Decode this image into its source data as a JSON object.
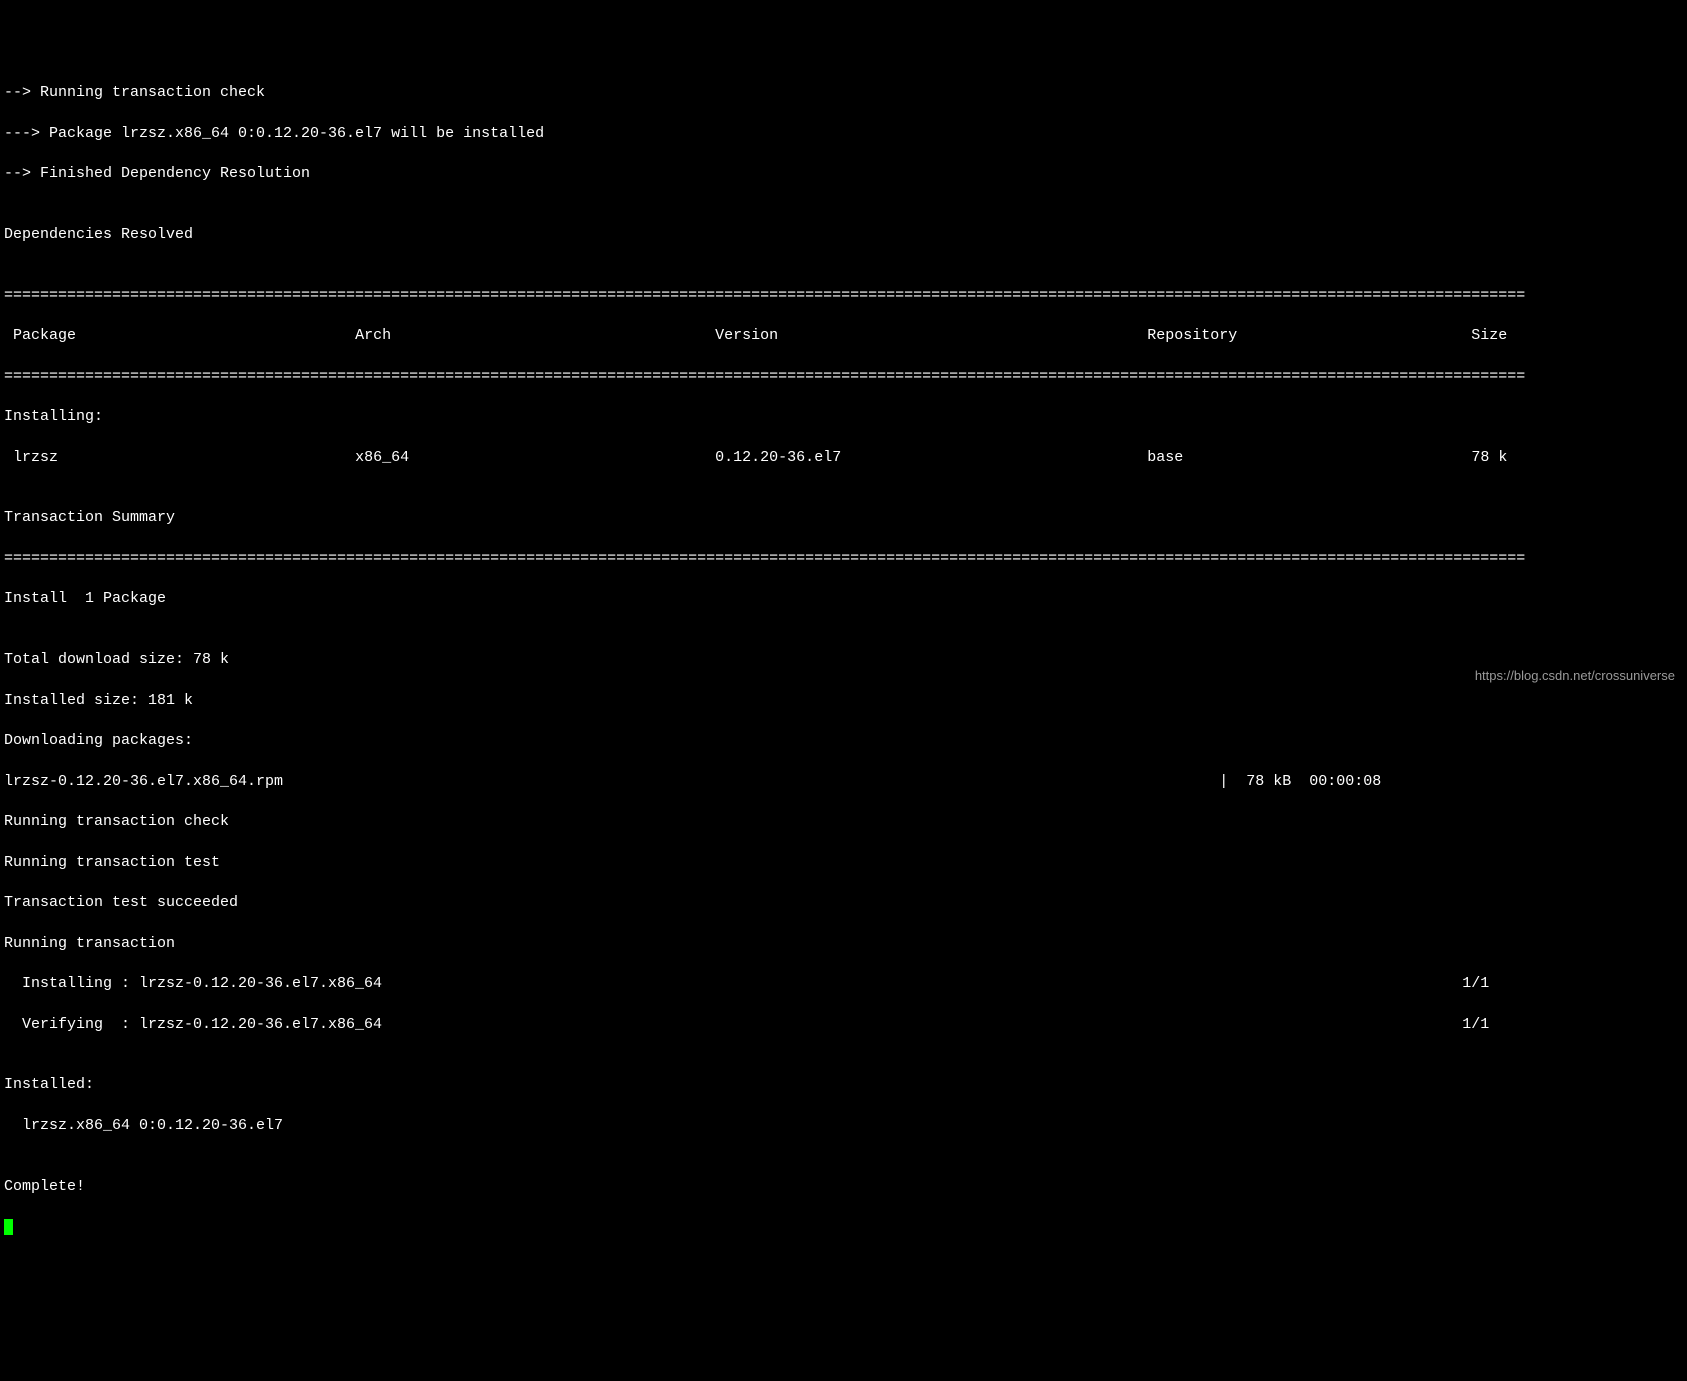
{
  "header": {
    "line1": "--> Running transaction check",
    "line2": "---> Package lrzsz.x86_64 0:0.12.20-36.el7 will be installed",
    "line3": "--> Finished Dependency Resolution",
    "blank": "",
    "deps_resolved": "Dependencies Resolved"
  },
  "rule": "=========================================================================================================================================================================",
  "columns": {
    "package": "Package",
    "arch": "Arch",
    "version": "Version",
    "repository": "Repository",
    "size": "Size"
  },
  "installing_label": "Installing:",
  "row": {
    "package": "lrzsz",
    "arch": "x86_64",
    "version": "0.12.20-36.el7",
    "repository": "base",
    "size": "78 k"
  },
  "tx_summary": "Transaction Summary",
  "install_count": "Install  1 Package",
  "totals": {
    "download": "Total download size: 78 k",
    "installed": "Installed size: 181 k",
    "downloading": "Downloading packages:"
  },
  "download_row": {
    "file": "lrzsz-0.12.20-36.el7.x86_64.rpm",
    "sep": "|",
    "size": "78 kB",
    "time": "00:00:08"
  },
  "progress": {
    "check": "Running transaction check",
    "test": "Running transaction test",
    "succeeded": "Transaction test succeeded",
    "running": "Running transaction"
  },
  "steps": {
    "installing": "  Installing : lrzsz-0.12.20-36.el7.x86_64",
    "installing_count": "1/1",
    "verifying": "  Verifying  : lrzsz-0.12.20-36.el7.x86_64",
    "verifying_count": "1/1"
  },
  "installed_block": {
    "label": "Installed:",
    "item": "  lrzsz.x86_64 0:0.12.20-36.el7"
  },
  "complete": "Complete!",
  "watermark": "https://blog.csdn.net/crossuniverse"
}
